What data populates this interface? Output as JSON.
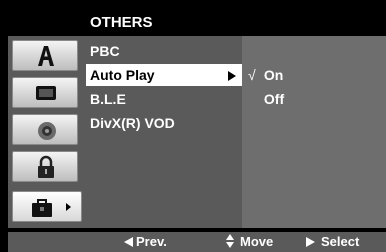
{
  "header": {
    "title": "OTHERS"
  },
  "sidebar": {
    "tabs": [
      {
        "icon": "letter-a-icon",
        "active": false
      },
      {
        "icon": "tv-screen-icon",
        "active": false
      },
      {
        "icon": "speaker-icon",
        "active": false
      },
      {
        "icon": "padlock-icon",
        "active": false
      },
      {
        "icon": "toolbox-icon",
        "active": true
      }
    ]
  },
  "menu": {
    "items": [
      {
        "label": "PBC",
        "selected": false
      },
      {
        "label": "Auto Play",
        "selected": true
      },
      {
        "label": "B.L.E",
        "selected": false
      },
      {
        "label": "DivX(R) VOD",
        "selected": false
      }
    ]
  },
  "submenu": {
    "options": [
      {
        "label": "On",
        "check": "√"
      },
      {
        "label": "Off",
        "check": ""
      }
    ]
  },
  "footer": {
    "prev": "Prev.",
    "move": "Move",
    "select": "Select"
  },
  "colors": {
    "panel": "#5a5a5a",
    "submenu_panel": "#6e6e6e",
    "selection": "#ffffff",
    "background": "#000000"
  }
}
